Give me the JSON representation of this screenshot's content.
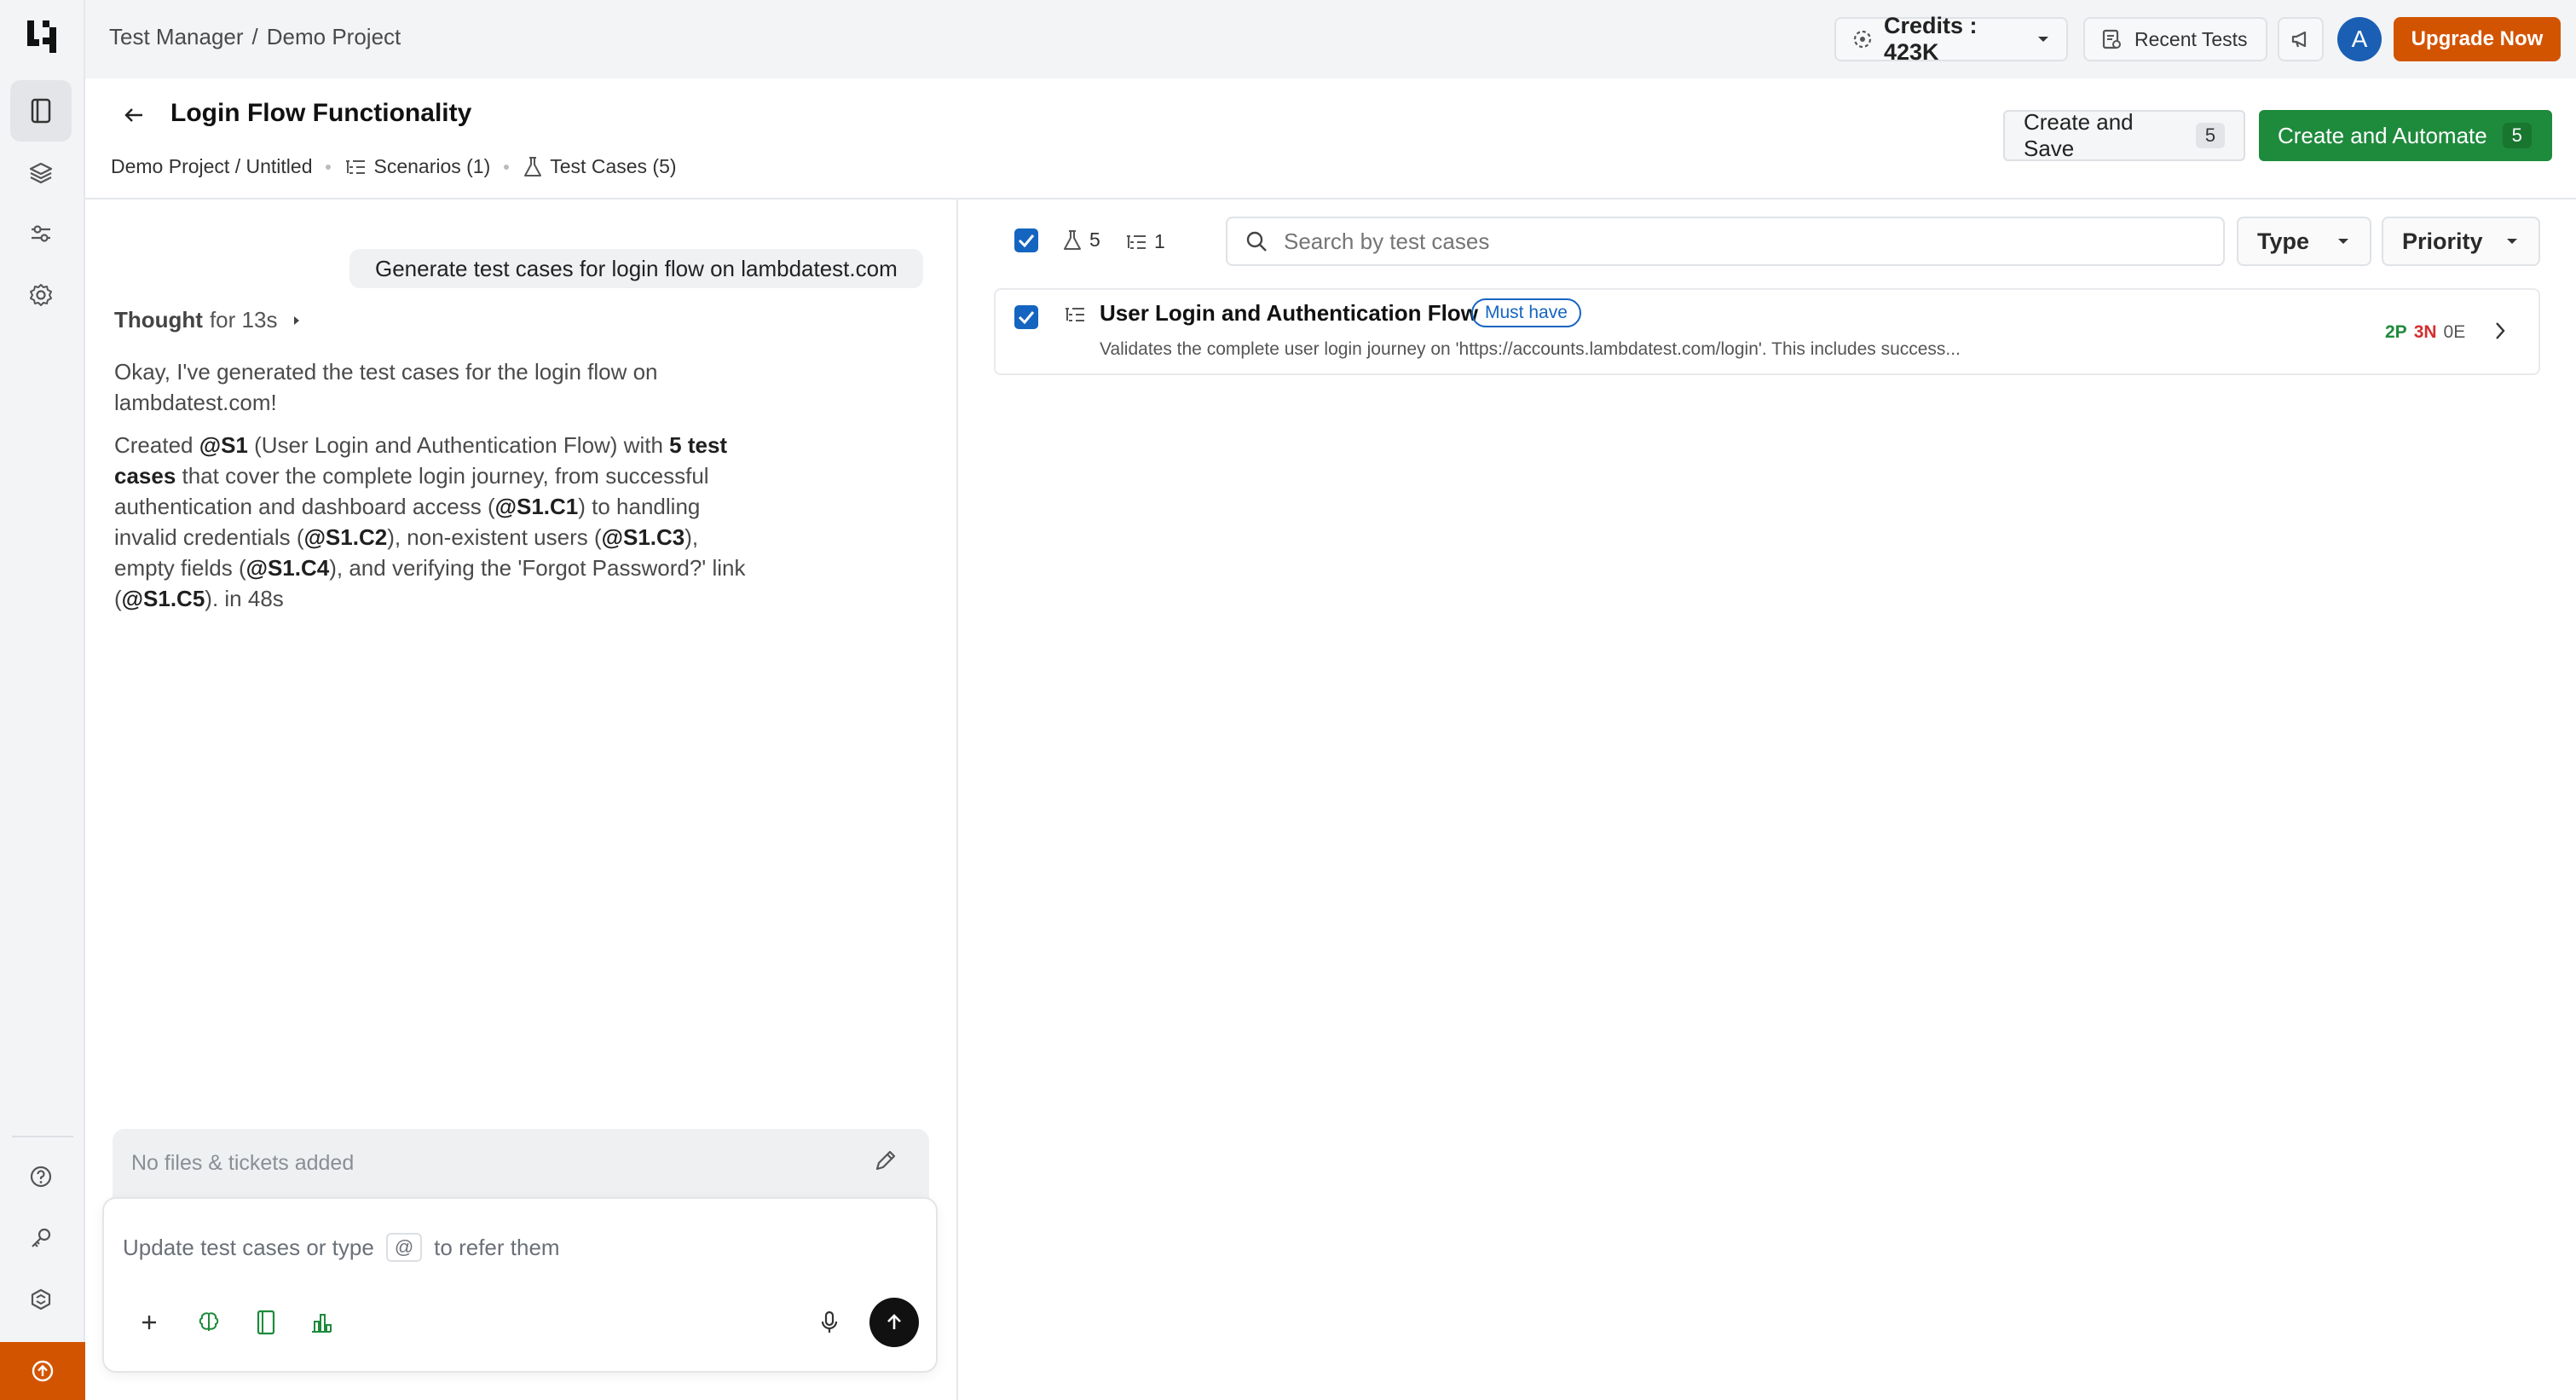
{
  "breadcrumb": {
    "root": "Test Manager",
    "sep": "/",
    "project": "Demo Project"
  },
  "topbar": {
    "credits_label": "Credits : 423K",
    "recent_tests_label": "Recent Tests",
    "avatar_initial": "A",
    "upgrade_label": "Upgrade Now"
  },
  "page": {
    "title": "Login Flow Functionality",
    "path": "Demo Project / Untitled",
    "scenarios_label": "Scenarios (1)",
    "testcases_label": "Test Cases (5)"
  },
  "actions": {
    "create_save_label": "Create and Save",
    "create_save_count": "5",
    "create_automate_label": "Create and Automate",
    "create_automate_count": "5"
  },
  "chat": {
    "user_prompt": "Generate test cases for login flow on lambdatest.com",
    "thought_label": "Thought",
    "thought_duration": "for 13s",
    "reply_line1": "Okay, I've generated the test cases for the login flow on lambdatest.com!",
    "reply_parts": [
      {
        "t": "Created ",
        "b": false
      },
      {
        "t": "@S1",
        "b": true
      },
      {
        "t": " (User Login and Authentication Flow) with ",
        "b": false
      },
      {
        "t": "5 test cases",
        "b": true
      },
      {
        "t": " that cover the complete login journey, from successful authentication and dashboard access (",
        "b": false
      },
      {
        "t": "@S1.C1",
        "b": true
      },
      {
        "t": ") to handling invalid credentials (",
        "b": false
      },
      {
        "t": "@S1.C2",
        "b": true
      },
      {
        "t": "), non-existent users (",
        "b": false
      },
      {
        "t": "@S1.C3",
        "b": true
      },
      {
        "t": "), empty fields (",
        "b": false
      },
      {
        "t": "@S1.C4",
        "b": true
      },
      {
        "t": "), and verifying the 'Forgot Password?' link (",
        "b": false
      },
      {
        "t": "@S1.C5",
        "b": true
      },
      {
        "t": "). in 48s",
        "b": false
      }
    ],
    "files_placeholder": "No files & tickets added",
    "input_placeholder_pre": "Update test cases or type",
    "input_at": "@",
    "input_placeholder_post": "to refer them"
  },
  "list": {
    "test_count": "5",
    "scenario_count": "1",
    "search_placeholder": "Search by test cases",
    "type_label": "Type",
    "priority_label": "Priority",
    "rows": [
      {
        "title": "User Login and Authentication Flow",
        "tag": "Must have",
        "description": "Validates the complete user login journey on 'https://accounts.lambdatest.com/login'. This includes success...",
        "pos": "2P",
        "neg": "3N",
        "edge": "0E"
      }
    ]
  },
  "colors": {
    "accent_orange": "#d35400",
    "green": "#1e8a3c",
    "blue": "#1565c0",
    "negative_red": "#d32f2f"
  },
  "icons": [
    "logo-icon",
    "test-manager-icon",
    "layers-icon",
    "settings-sliders-icon",
    "gear-icon",
    "help-icon",
    "key-icon",
    "integrations-icon",
    "upgrade-icon",
    "credits-icon",
    "recent-tests-icon",
    "announcement-icon",
    "back-arrow-icon",
    "scenario-icon",
    "flask-icon",
    "search-icon",
    "chevron-down-icon",
    "chevron-right-icon",
    "pencil-icon",
    "plus-icon",
    "brain-icon",
    "notebook-icon",
    "analytics-icon",
    "mic-icon",
    "send-arrow-icon"
  ]
}
